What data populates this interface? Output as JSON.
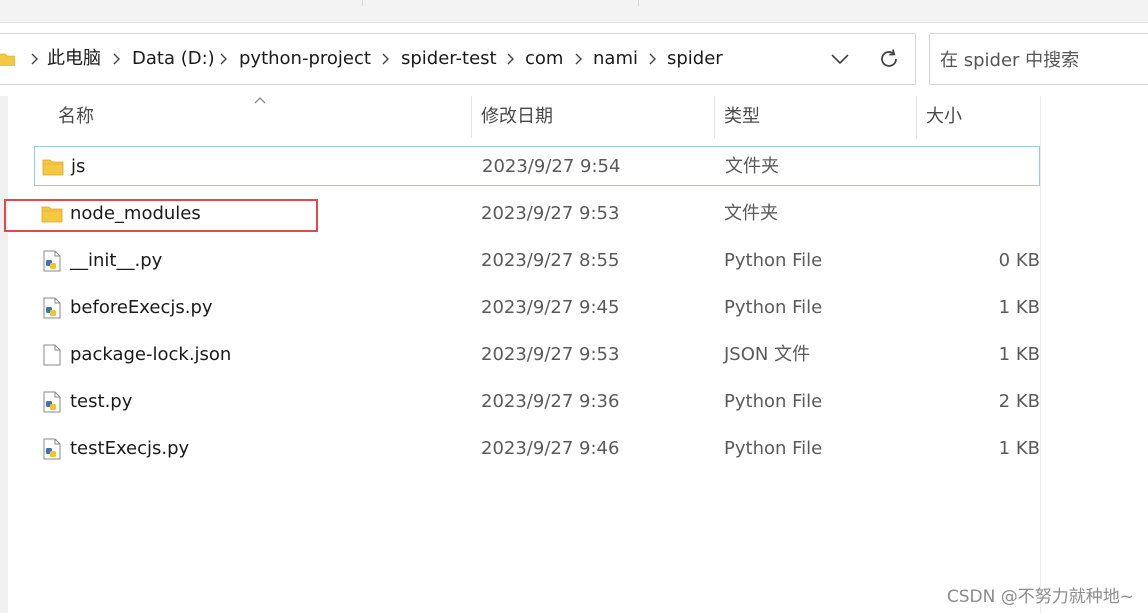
{
  "breadcrumb": {
    "items": [
      "此电脑",
      "Data (D:)",
      "python-project",
      "spider-test",
      "com",
      "nami",
      "spider"
    ]
  },
  "search": {
    "placeholder": "在 spider 中搜索"
  },
  "columns": {
    "name": "名称",
    "date": "修改日期",
    "type": "类型",
    "size": "大小"
  },
  "files": [
    {
      "name": "js",
      "date": "2023/9/27 9:54",
      "type": "文件夹",
      "size": "",
      "icon": "folder-icon"
    },
    {
      "name": "node_modules",
      "date": "2023/9/27 9:53",
      "type": "文件夹",
      "size": "",
      "icon": "folder-icon"
    },
    {
      "name": "__init__.py",
      "date": "2023/9/27 8:55",
      "type": "Python File",
      "size": "0 KB",
      "icon": "python-file-icon"
    },
    {
      "name": "beforeExecjs.py",
      "date": "2023/9/27 9:45",
      "type": "Python File",
      "size": "1 KB",
      "icon": "python-file-icon"
    },
    {
      "name": "package-lock.json",
      "date": "2023/9/27 9:53",
      "type": "JSON 文件",
      "size": "1 KB",
      "icon": "json-file-icon"
    },
    {
      "name": "test.py",
      "date": "2023/9/27 9:36",
      "type": "Python File",
      "size": "2 KB",
      "icon": "python-file-icon"
    },
    {
      "name": "testExecjs.py",
      "date": "2023/9/27 9:46",
      "type": "Python File",
      "size": "1 KB",
      "icon": "python-file-icon"
    }
  ],
  "watermark": "CSDN @不努力就种地~",
  "colors": {
    "selection_border": "#99c9e8",
    "highlight_box": "#e04a4a",
    "folder": "#f5c842"
  }
}
